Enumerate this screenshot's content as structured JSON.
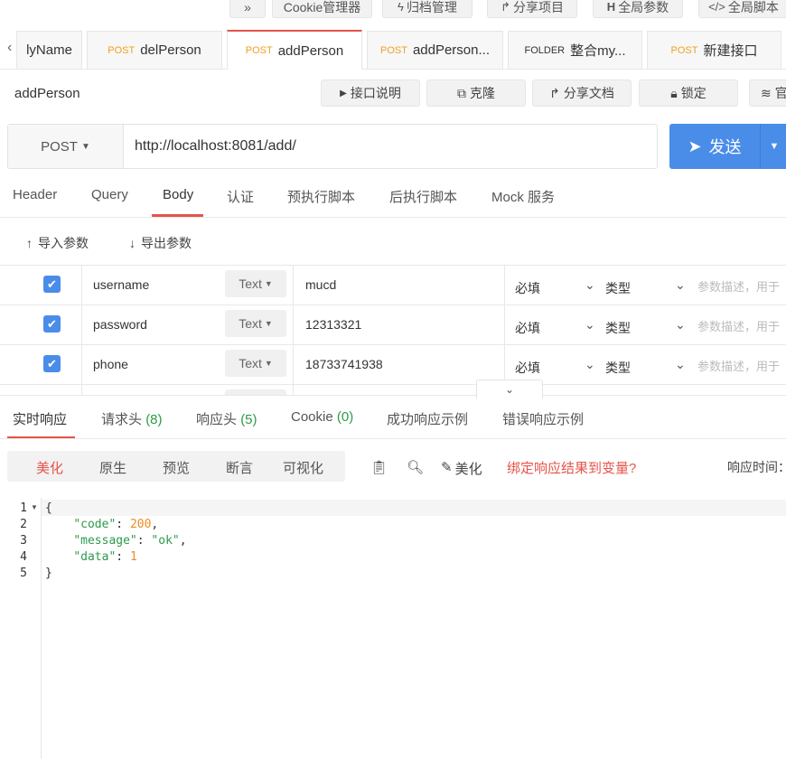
{
  "toolbar": [
    {
      "label": "»",
      "icon": "double-chevron"
    },
    {
      "label": "Cookie管理器",
      "icon": ""
    },
    {
      "label": "归档管理",
      "icon": "bolt"
    },
    {
      "label": "分享项目",
      "icon": "share"
    },
    {
      "label": "全局参数",
      "icon": "H"
    },
    {
      "label": "全局脚本",
      "icon": "code"
    }
  ],
  "tabs": [
    {
      "method": "",
      "label": "lyName"
    },
    {
      "method": "POST",
      "label": "delPerson"
    },
    {
      "method": "POST",
      "label": "addPerson"
    },
    {
      "method": "POST",
      "label": "addPerson..."
    },
    {
      "method": "FOLDER",
      "label": "整合my..."
    },
    {
      "method": "POST",
      "label": "新建接口"
    }
  ],
  "title": "addPerson",
  "actions": {
    "doc": "接口说明",
    "clone": "克隆",
    "share": "分享文档",
    "lock": "锁定",
    "more": "官"
  },
  "request": {
    "method": "POST",
    "url": "http://localhost:8081/add/",
    "send": "发送"
  },
  "subtabs": [
    "Header",
    "Query",
    "Body",
    "认证",
    "预执行脚本",
    "后执行脚本",
    "Mock 服务"
  ],
  "import_label": "导入参数",
  "export_label": "导出参数",
  "params": [
    {
      "name": "username",
      "type": "Text",
      "value": "mucd",
      "required": "必填",
      "kind": "类型",
      "desc": "参数描述，用于"
    },
    {
      "name": "password",
      "type": "Text",
      "value": "12313321",
      "required": "必填",
      "kind": "类型",
      "desc": "参数描述，用于"
    },
    {
      "name": "phone",
      "type": "Text",
      "value": "18733741938",
      "required": "必填",
      "kind": "类型",
      "desc": "参数描述，用于"
    }
  ],
  "response_tabs": [
    {
      "label": "实时响应",
      "count": ""
    },
    {
      "label": "请求头",
      "count": "(8)"
    },
    {
      "label": "响应头",
      "count": "(5)"
    },
    {
      "label": "Cookie",
      "count": "(0)"
    },
    {
      "label": "成功响应示例",
      "count": ""
    },
    {
      "label": "错误响应示例",
      "count": ""
    }
  ],
  "view_modes": [
    "美化",
    "原生",
    "预览",
    "断言",
    "可视化"
  ],
  "beautify_label": "美化",
  "bind_label": "绑定响应结果到变量?",
  "response_time_label": "响应时间：",
  "code_lines": [
    "{",
    "    \"code\": 200,",
    "    \"message\": \"ok\",",
    "    \"data\": 1",
    "}"
  ],
  "colors": {
    "accent": "#e5544a",
    "primary": "#4a8de8",
    "key": "#2d9a4a",
    "number": "#f08a24"
  }
}
